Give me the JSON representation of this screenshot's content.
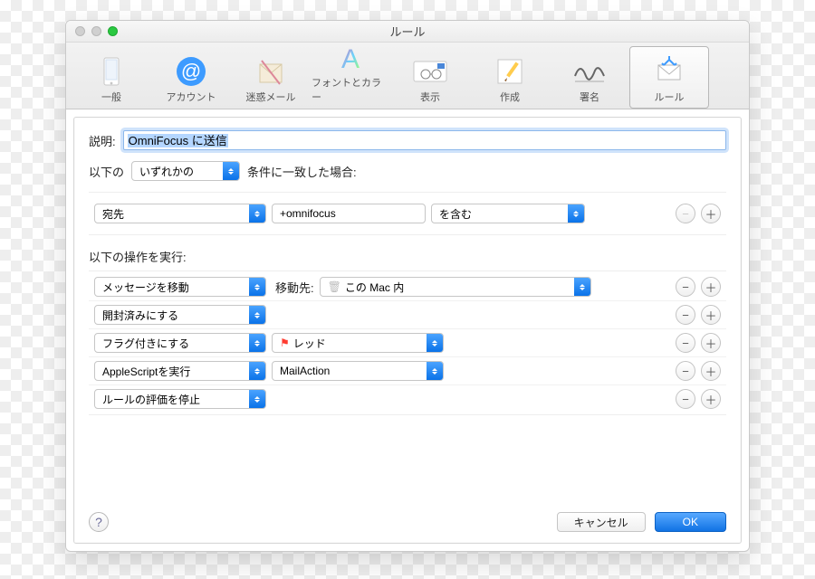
{
  "window": {
    "title": "ルール"
  },
  "toolbar": {
    "items": [
      {
        "label": "一般"
      },
      {
        "label": "アカウント"
      },
      {
        "label": "迷惑メール"
      },
      {
        "label": "フォントとカラー"
      },
      {
        "label": "表示"
      },
      {
        "label": "作成"
      },
      {
        "label": "署名"
      },
      {
        "label": "ルール"
      }
    ]
  },
  "description": {
    "label": "説明:",
    "value": "OmniFocus に送信"
  },
  "conditions": {
    "prefix": "以下の",
    "match_mode": "いずれかの",
    "suffix": "条件に一致した場合:",
    "rows": [
      {
        "field": "宛先",
        "value": "+omnifocus",
        "op": "を含む"
      }
    ]
  },
  "actions": {
    "header": "以下の操作を実行:",
    "rows": [
      {
        "type": "メッセージを移動",
        "target_label": "移動先:",
        "target": "この Mac 内",
        "icon": "trash"
      },
      {
        "type": "開封済みにする"
      },
      {
        "type": "フラグ付きにする",
        "target": "レッド",
        "icon": "flag"
      },
      {
        "type": "AppleScriptを実行",
        "target": "MailAction"
      },
      {
        "type": "ルールの評価を停止"
      }
    ]
  },
  "buttons": {
    "cancel": "キャンセル",
    "ok": "OK"
  }
}
